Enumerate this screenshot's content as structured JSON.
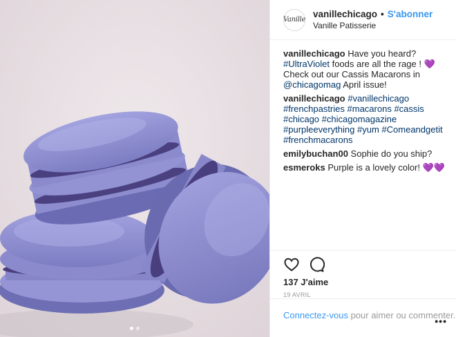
{
  "photo": {
    "alt_desc_color_bg": "#e8dfe3",
    "carousel": {
      "count": 2,
      "active": 0
    }
  },
  "header": {
    "avatar_text": "Vanille",
    "username": "vanillechicago",
    "separator": "•",
    "follow_label": "S'abonner",
    "location": "Vanille Patisserie"
  },
  "comments": [
    {
      "user": "vanillechicago",
      "parts": [
        {
          "text": " Have you heard? "
        },
        {
          "text": "#UltraViolet",
          "link": true
        },
        {
          "text": " foods are all the rage ! "
        },
        {
          "text": "💜",
          "heart": true
        },
        {
          "text": " Check out our Cassis Macarons in "
        },
        {
          "text": "@chicagomag",
          "link": true
        },
        {
          "text": " April issue!"
        }
      ]
    },
    {
      "user": "vanillechicago",
      "parts": [
        {
          "text": " "
        },
        {
          "text": "#vanillechicago",
          "link": true
        },
        {
          "text": " "
        },
        {
          "text": "#frenchpastries",
          "link": true
        },
        {
          "text": " "
        },
        {
          "text": "#macarons",
          "link": true
        },
        {
          "text": " "
        },
        {
          "text": "#cassis",
          "link": true
        },
        {
          "text": " "
        },
        {
          "text": "#chicago",
          "link": true
        },
        {
          "text": " "
        },
        {
          "text": "#chicagomagazine",
          "link": true
        },
        {
          "text": " "
        },
        {
          "text": "#purpleeverything",
          "link": true
        },
        {
          "text": " "
        },
        {
          "text": "#yum",
          "link": true
        },
        {
          "text": " "
        },
        {
          "text": "#Comeandgetit",
          "link": true
        },
        {
          "text": " "
        },
        {
          "text": "#frenchmacarons",
          "link": true
        }
      ]
    },
    {
      "user": "emilybuchan00",
      "parts": [
        {
          "text": " Sophie do you ship?"
        }
      ]
    },
    {
      "user": "esmeroks",
      "parts": [
        {
          "text": " Purple is a lovely color! "
        },
        {
          "text": "💜💜",
          "heart": true
        }
      ]
    }
  ],
  "actions": {
    "like_icon": "heart-outline-icon",
    "comment_icon": "comment-bubble-icon",
    "likes_label": "137 J'aime",
    "date": "19 AVRIL"
  },
  "footer": {
    "login_label": "Connectez-vous",
    "rest_label": " pour aimer ou commenter.",
    "more_label": "•••"
  },
  "colors": {
    "accent": "#3897f0",
    "link": "#003569",
    "heart": "#8a5cd8",
    "macaron": "#8f8fd2"
  }
}
